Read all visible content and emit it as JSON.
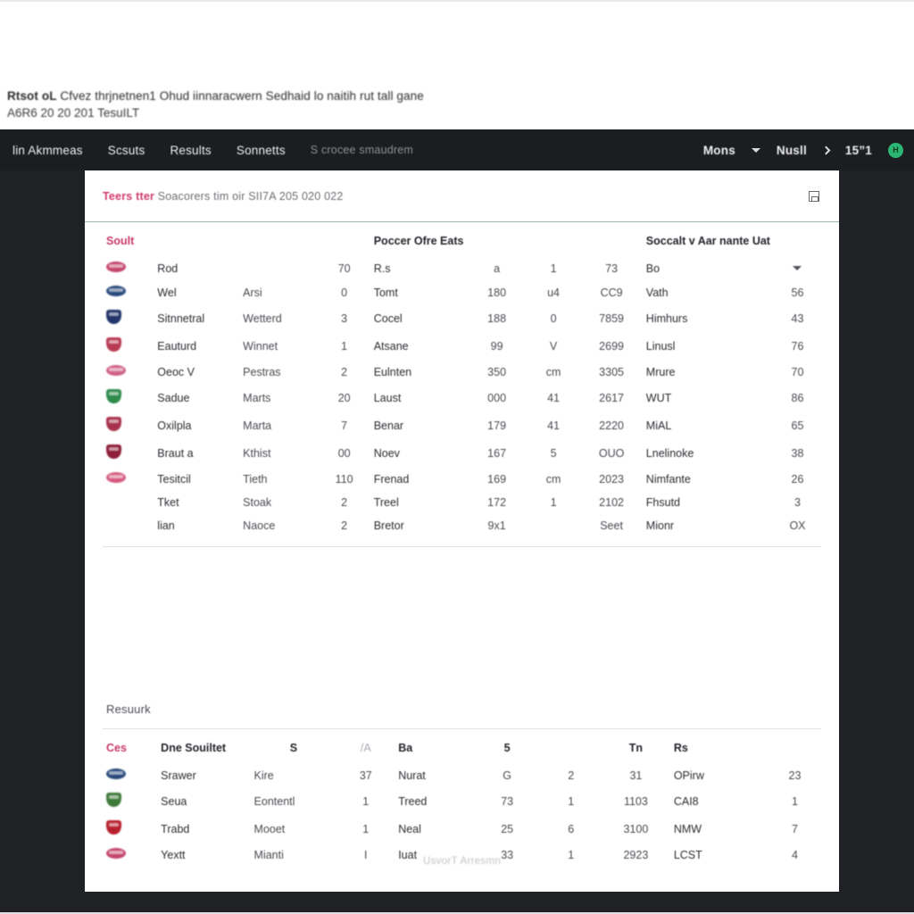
{
  "page": {
    "heading_lead": "Rtsot oL",
    "heading_rest": " Cfvez thrjnetnen1 Ohud iinnaracwern Sedhaid lo naitih rut tall gane",
    "subheading": "A6R6  20 20 201 TesuILT",
    "footer_note": "UsvorT Arresmn"
  },
  "navbar": {
    "items": [
      {
        "label": "lin Akmmeas",
        "muted": false
      },
      {
        "label": "Scsuts",
        "muted": false
      },
      {
        "label": "Results",
        "muted": false
      },
      {
        "label": "Sonnetts",
        "muted": false
      },
      {
        "label": "S crocee smaudrem",
        "muted": true
      }
    ],
    "right": {
      "menu_label": "Mons",
      "chevron_down_icon": "chevron-down-icon",
      "secondary_label": "Nusll",
      "chevron_right_icon": "chevron-right-icon",
      "counter": "15”1",
      "avatar_initial": "H"
    }
  },
  "card_header": {
    "pink_lead": "Teers tter",
    "rest": " Soacorers tim oir SII7A 205 020 022",
    "save_icon": "save-icon"
  },
  "table_one": {
    "headers": {
      "crest": "Soult",
      "col_a": "",
      "col_b": "",
      "col_c": "",
      "col_d": "Poccer Ofre Eats",
      "col_e": "",
      "col_f": "",
      "col_g": "",
      "col_h": "Soccalt v Aar nante Uat",
      "col_i": ""
    },
    "rows": [
      {
        "crest": "#c4456d",
        "shape": "wide",
        "a": "Rod",
        "b": "",
        "c": "70",
        "d": "R.s",
        "e": "a",
        "f": "1",
        "g": "73",
        "h": "Bo",
        "i": "chevron"
      },
      {
        "crest": "#2a4a7c",
        "shape": "wide",
        "a": "Wel",
        "b": "Arsi",
        "c": "0",
        "d": "Tomt",
        "e": "180",
        "f": "u4",
        "g": "CC9",
        "h": "Vath",
        "i": "56"
      },
      {
        "crest": "#23356b",
        "shape": "shield",
        "a": "Sitnnetral",
        "b": "Wetterd",
        "c": "3",
        "d": "Cocel",
        "e": "188",
        "f": "0",
        "g": "7859",
        "h": "Himhurs",
        "i": "43"
      },
      {
        "crest": "#b83a52",
        "shape": "shield",
        "a": "Eauturd",
        "b": "Winnet",
        "c": "1",
        "d": "Atsane",
        "e": "99",
        "f": "V",
        "g": "2699",
        "h": "Linusl",
        "i": "76"
      },
      {
        "crest": "#cf5f86",
        "shape": "wide",
        "a": "Oeoc V",
        "b": "Pestras",
        "c": "2",
        "d": "Eulnten",
        "e": "350",
        "f": "cm",
        "g": "3305",
        "h": "Mrure",
        "i": "70"
      },
      {
        "crest": "#2f8b4c",
        "shape": "shield",
        "a": "Sadue",
        "b": "Marts",
        "c": "20",
        "d": "Laust",
        "e": "000",
        "f": "41",
        "g": "2617",
        "h": "WUT",
        "i": "86"
      },
      {
        "crest": "#a8324c",
        "shape": "shield",
        "a": "Oxilpla",
        "b": "Marta",
        "c": "7",
        "d": "Benar",
        "e": "179",
        "f": "41",
        "g": "2220",
        "h": "MiAL",
        "i": "65"
      },
      {
        "crest": "#8e1f3a",
        "shape": "shield",
        "a": "Braut a",
        "b": "Kthist",
        "c": "00",
        "d": "Noev",
        "e": "167",
        "f": "5",
        "g": "OUO",
        "h": "Lnelinoke",
        "i": "38"
      },
      {
        "crest": "#d4587f",
        "shape": "wide",
        "a": "Tesitcil",
        "b": "Tieth",
        "c": "110",
        "d": "Frenad",
        "e": "169",
        "f": "cm",
        "g": "2023",
        "h": "Nimfante",
        "i": "26"
      },
      {
        "crest": "",
        "shape": "none",
        "a": "Tket",
        "b": "Stoak",
        "c": "2",
        "d": "Treel",
        "e": "172",
        "f": "1",
        "g": "2102",
        "h": "Fhsutd",
        "i": "3"
      },
      {
        "crest": "",
        "shape": "none",
        "a": "lian",
        "b": "Naoce",
        "c": "2",
        "d": "Bretor",
        "e": "9x1",
        "f": "",
        "g": "Seet",
        "h": "Mionr",
        "i": "OX"
      }
    ]
  },
  "section_two": {
    "title": "Resuurk"
  },
  "table_two": {
    "headers": {
      "crest": "Ces",
      "col_a": "Dne Souiltet",
      "col_b": "S",
      "col_c": "/A",
      "col_d": "Ba",
      "col_e": "5",
      "col_f": "",
      "col_g": "Tn",
      "col_h": "Rs",
      "col_i": ""
    },
    "rows": [
      {
        "crest": "#2a4a7c",
        "shape": "wide",
        "a": "Srawer",
        "b": "Kire",
        "c": "37",
        "d": "Nurat",
        "e": "G",
        "f": "2",
        "g": "31",
        "h": "OPirw",
        "i": "23"
      },
      {
        "crest": "#3f7a3a",
        "shape": "shield",
        "a": "Seua",
        "b": "Eontentl",
        "c": "1",
        "d": "Treed",
        "e": "73",
        "f": "1",
        "g": "1103",
        "h": "CAI8",
        "i": "1"
      },
      {
        "crest": "#b8202e",
        "shape": "shield",
        "a": "Trabd",
        "b": "Mooet",
        "c": "1",
        "d": "Neal",
        "e": "25",
        "f": "6",
        "g": "3100",
        "h": "NMW",
        "i": "7"
      },
      {
        "crest": "#c4456d",
        "shape": "wide",
        "a": "Yextt",
        "b": "Mianti",
        "c": "I",
        "d": "Iuat",
        "e": "33",
        "f": "1",
        "g": "2923",
        "h": "LCST",
        "i": "4"
      }
    ]
  },
  "colors": {
    "nav_bg": "#1b1d20",
    "page_bg": "#1f2124",
    "accent_pink": "#c8386a",
    "accent_green": "#9bb8ab",
    "avatar_green": "#2bb673"
  }
}
